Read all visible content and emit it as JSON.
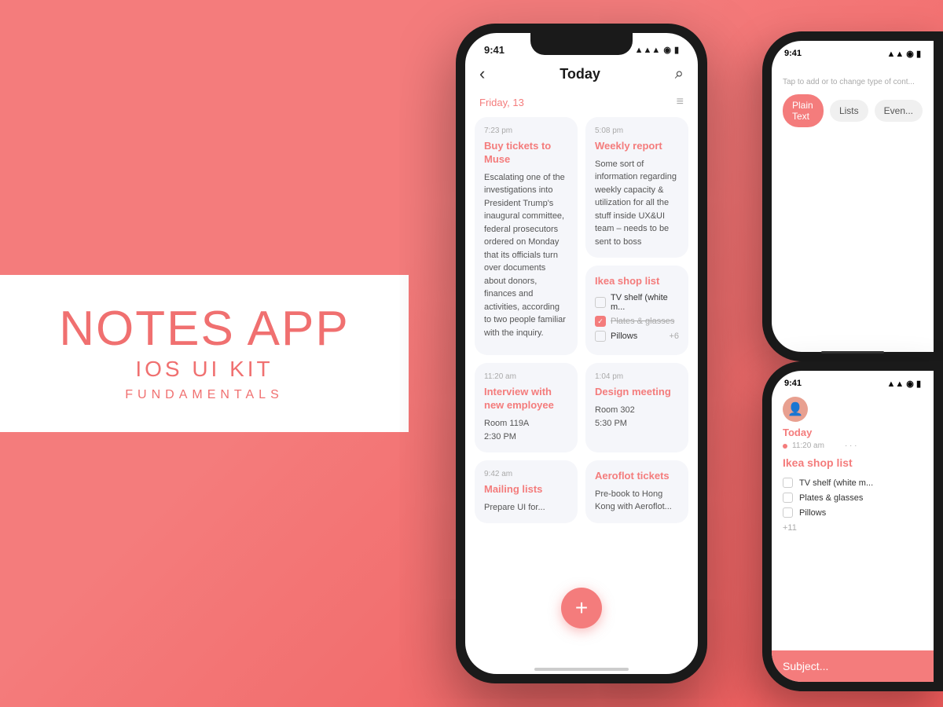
{
  "app": {
    "title": "NOTES APP",
    "subtitle": "IOS UI KIT",
    "sub2": "FUNDAMENTALS"
  },
  "main_phone": {
    "status_time": "9:41",
    "nav_title": "Today",
    "date_label": "Friday, 13",
    "notes": [
      {
        "id": "note1",
        "time": "7:23 pm",
        "title": "Buy tickets to Muse",
        "text": "Escalating one of the investigations into President Trump's inaugural committee, federal prosecutors ordered on Monday that its officials turn over documents about donors, finances and activities, according to two people familiar with the inquiry.",
        "col": "left"
      },
      {
        "id": "note2",
        "time": "5:08 pm",
        "title": "Weekly report",
        "text": "Some sort of information regarding weekly capacity & utilization for all the stuff inside UX&UI team – needs to be sent to boss",
        "col": "right"
      },
      {
        "id": "note3",
        "title": "Ikea shop list",
        "time": "",
        "type": "checklist",
        "items": [
          {
            "text": "TV shelf (white m...",
            "checked": false
          },
          {
            "text": "Plates & glasses",
            "checked": true
          },
          {
            "text": "Pillows",
            "checked": false
          }
        ],
        "extra_count": "+6",
        "col": "right"
      },
      {
        "id": "note4",
        "time": "11:20 am",
        "title": "Interview with new employee",
        "text": "Room 119A\n2:30 PM",
        "col": "left"
      },
      {
        "id": "note5",
        "time": "1:04 pm",
        "title": "Design meeting",
        "text": "Room 302\n5:30 PM",
        "col": "right"
      },
      {
        "id": "note6",
        "time": "9:42 am",
        "title": "Mailing lists",
        "text": "Prepare UI for...",
        "col": "left"
      },
      {
        "id": "note7",
        "time": "",
        "title": "Aeroflot tickets",
        "text": "Pre-book to Hong Kong with Aeroflot...",
        "col": "right"
      }
    ]
  },
  "right_top_phone": {
    "status_time": "9:41",
    "hint": "Tap to add or to change type of cont...",
    "buttons": [
      "Plain Text",
      "Lists",
      "Even..."
    ],
    "active_button": "Plain Text"
  },
  "right_bottom_phone": {
    "status_time": "9:41",
    "today_label": "Today",
    "time": "11:20 am",
    "card_title": "Ikea shop list",
    "items": [
      {
        "text": "TV shelf (white m...",
        "checked": false
      },
      {
        "text": "Plates & glasses",
        "checked": false
      },
      {
        "text": "Pillows",
        "checked": false
      }
    ],
    "extra_count": "+11",
    "subject_placeholder": "Subject..."
  },
  "icons": {
    "back": "‹",
    "search": "○",
    "filter": "≡",
    "plus": "+",
    "signal": "▲▲▲",
    "wifi": "◉",
    "battery": "▮"
  }
}
